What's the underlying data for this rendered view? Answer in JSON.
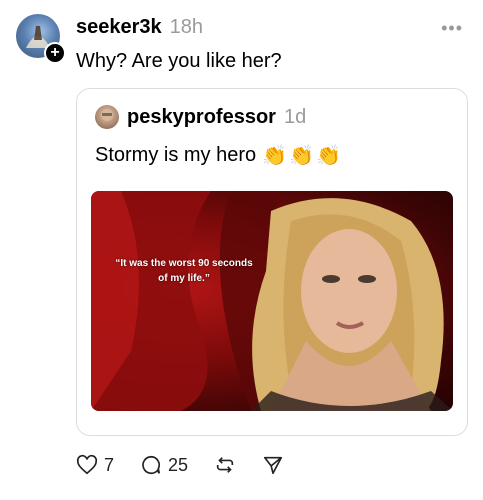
{
  "post": {
    "username": "seeker3k",
    "timestamp": "18h",
    "text": "Why? Are you like her?"
  },
  "quote": {
    "username": "peskyprofessor",
    "timestamp": "1d",
    "text": "Stormy is my hero",
    "emoji": "👏👏👏",
    "caption_line1": "“It was the worst 90 seconds",
    "caption_line2": "of my life.”"
  },
  "actions": {
    "likes": "7",
    "replies": "25"
  },
  "icons": {
    "more": "more-icon",
    "follow": "plus-icon",
    "like": "heart-icon",
    "reply": "comment-icon",
    "repost": "repost-icon",
    "share": "send-icon"
  }
}
